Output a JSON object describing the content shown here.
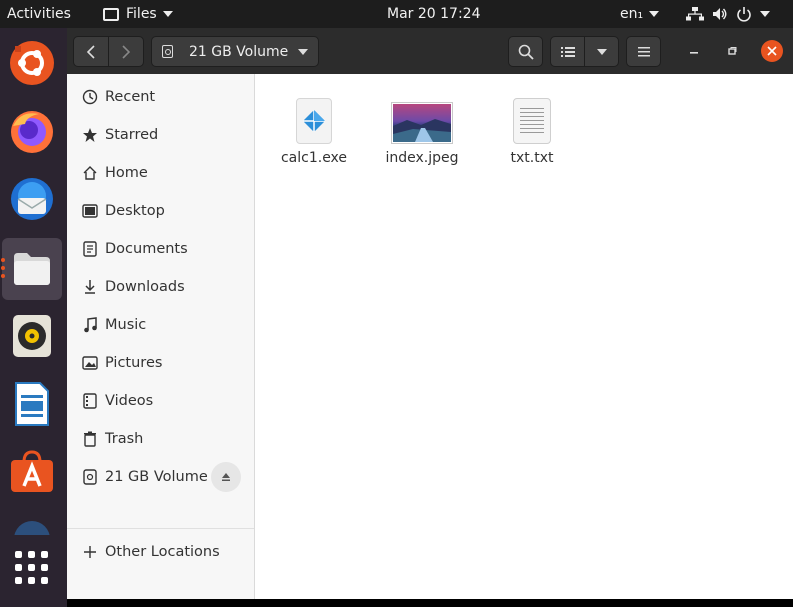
{
  "topbar": {
    "activities": "Activities",
    "app_menu": "Files",
    "clock": "Mar 20  17:24",
    "language": "en₁"
  },
  "dock": {
    "apps": [
      {
        "name": "ubuntu-software-icon"
      },
      {
        "name": "firefox-icon"
      },
      {
        "name": "thunderbird-icon"
      },
      {
        "name": "files-icon"
      },
      {
        "name": "rhythmbox-icon"
      },
      {
        "name": "libreoffice-writer-icon"
      },
      {
        "name": "app-center-icon"
      }
    ]
  },
  "window": {
    "location": "21 GB Volume",
    "sidebar": {
      "items": [
        {
          "label": "Recent",
          "icon": "clock-icon"
        },
        {
          "label": "Starred",
          "icon": "star-icon"
        },
        {
          "label": "Home",
          "icon": "home-icon"
        },
        {
          "label": "Desktop",
          "icon": "desktop-icon"
        },
        {
          "label": "Documents",
          "icon": "document-icon"
        },
        {
          "label": "Downloads",
          "icon": "download-icon"
        },
        {
          "label": "Music",
          "icon": "music-icon"
        },
        {
          "label": "Pictures",
          "icon": "pictures-icon"
        },
        {
          "label": "Videos",
          "icon": "video-icon"
        },
        {
          "label": "Trash",
          "icon": "trash-icon"
        },
        {
          "label": "21 GB Volume",
          "icon": "drive-icon"
        }
      ],
      "other_locations": "Other Locations"
    },
    "files": [
      {
        "name": "calc1.exe",
        "icon": "executable-icon"
      },
      {
        "name": "index.jpeg",
        "icon": "image-thumbnail"
      },
      {
        "name": "txt.txt",
        "icon": "text-file-icon"
      }
    ]
  },
  "colors": {
    "accent": "#e95420",
    "topbar_bg": "#1d1d1d",
    "dock_bg": "#2b2430",
    "headerbar_bg": "#2c2c2c",
    "sidebar_bg": "#f7f7f7"
  }
}
